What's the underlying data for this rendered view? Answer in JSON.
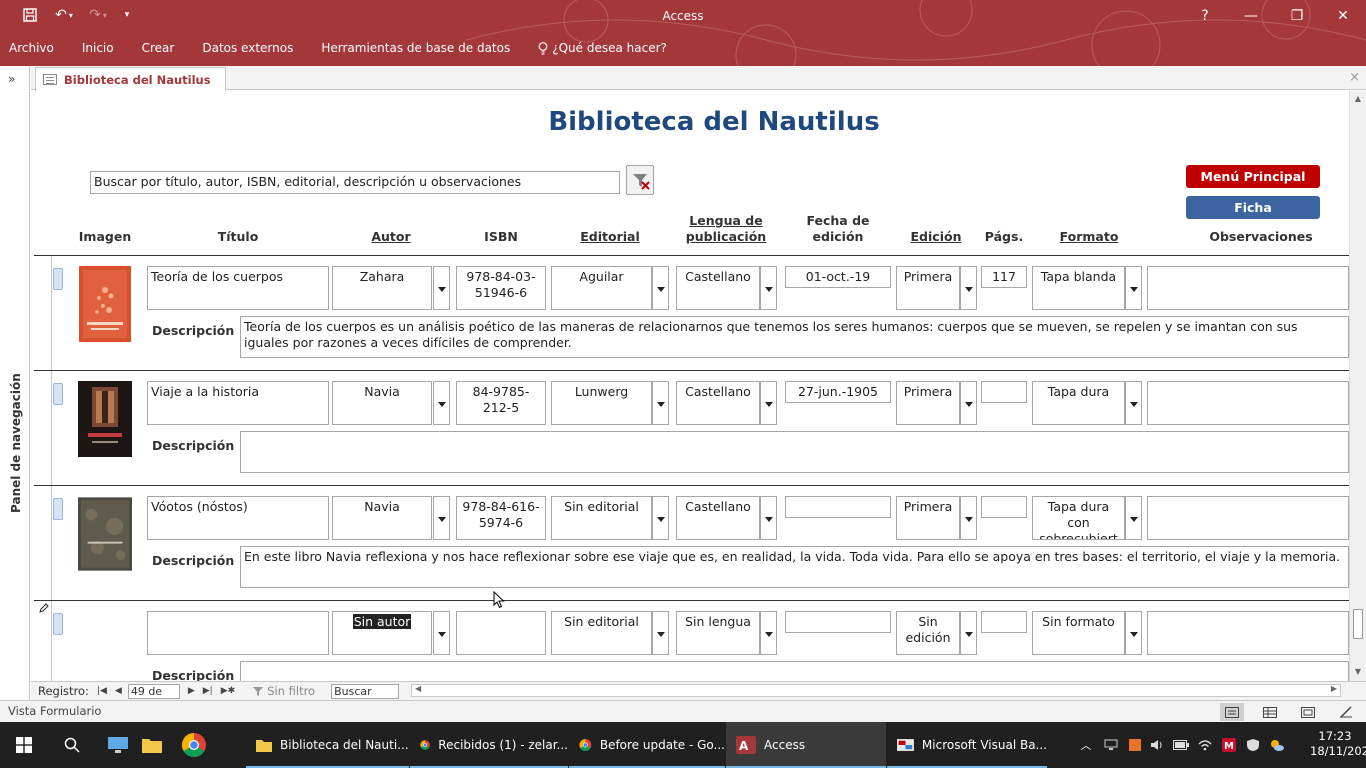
{
  "window": {
    "title": "Access",
    "help": "?",
    "minimize": "—",
    "restore": "❐",
    "close": "✕"
  },
  "ribbon": {
    "tabs": [
      "Archivo",
      "Inicio",
      "Crear",
      "Datos externos",
      "Herramientas de base de datos"
    ],
    "tell_me": "¿Qué desea hacer?"
  },
  "nav_pane": {
    "label": "Panel de navegación",
    "toggle": "»"
  },
  "doc_tab": {
    "label": "Biblioteca del Nautilus",
    "close": "×"
  },
  "form": {
    "title": "Biblioteca del Nautilus",
    "search_value": "Buscar por título, autor, ISBN, editorial, descripción u observaciones",
    "buttons": {
      "menu": "Menú Principal",
      "ficha": "Ficha"
    },
    "headers": {
      "imagen": "Imagen",
      "titulo": "Título",
      "autor": "Autor",
      "isbn": "ISBN",
      "editorial": "Editorial",
      "lengua": "Lengua de publicación",
      "fecha": "Fecha de edición",
      "edicion": "Edición",
      "pags": "Págs.",
      "formato": "Formato",
      "observaciones": "Observaciones"
    },
    "desc_label": "Descripción",
    "records": [
      {
        "titulo": "Teoría de los cuerpos",
        "autor": "Zahara",
        "isbn": "978-84-03-51946-6",
        "editorial": "Aguilar",
        "lengua": "Castellano",
        "fecha": "01-oct.-19",
        "edicion": "Primera",
        "pags": "117",
        "formato": "Tapa blanda",
        "observaciones": "",
        "descripcion": "Teoría de los cuerpos es un análisis poético de las maneras de relacionarnos que tenemos los seres humanos: cuerpos que se mueven, se repelen y se imantan con sus iguales por razones a veces difíciles de comprender."
      },
      {
        "titulo": "Viaje a la historia",
        "autor": "Navia",
        "isbn": "84-9785-212-5",
        "editorial": "Lunwerg",
        "lengua": "Castellano",
        "fecha": "27-jun.-1905",
        "edicion": "Primera",
        "pags": "",
        "formato": "Tapa dura",
        "observaciones": "",
        "descripcion": ""
      },
      {
        "titulo": "Vóotos (nóstos)",
        "autor": "Navia",
        "isbn": "978-84-616-5974-6",
        "editorial": "Sin editorial",
        "lengua": "Castellano",
        "fecha": "",
        "edicion": "Primera",
        "pags": "",
        "formato": "Tapa dura con sobrecubiert",
        "observaciones": "",
        "descripcion": "En este libro Navia reflexiona y nos hace reflexionar sobre ese viaje que es, en realidad, la vida. Toda vida. Para ello se apoya en tres bases: el territorio, el viaje y la memoria."
      },
      {
        "titulo": "",
        "autor": "Sin autor",
        "isbn": "",
        "editorial": "Sin editorial",
        "lengua": "Sin lengua",
        "fecha": "",
        "edicion": "Sin edición",
        "pags": "",
        "formato": "Sin formato",
        "observaciones": "",
        "descripcion": ""
      }
    ]
  },
  "navbar": {
    "label": "Registro:",
    "position": "49 de 49",
    "filter": "Sin filtro",
    "search": "Buscar"
  },
  "status": {
    "text": "Vista Formulario"
  },
  "taskbar": {
    "apps": [
      {
        "label": "Biblioteca del Nauti...",
        "icon": "folder-icon"
      },
      {
        "label": "Recibidos (1) - zelar...",
        "icon": "chrome-icon"
      },
      {
        "label": "Before update - Go...",
        "icon": "chrome-icon"
      },
      {
        "label": "Access",
        "icon": "access-icon"
      },
      {
        "label": "Microsoft Visual Ba...",
        "icon": "vba-icon"
      }
    ],
    "time": "17:23",
    "date": "18/11/2020"
  },
  "colors": {
    "title_bar": "#a4373a",
    "form_title": "#1f497d",
    "menu_button": "#c00000",
    "ficha_button": "#3b64a1"
  }
}
